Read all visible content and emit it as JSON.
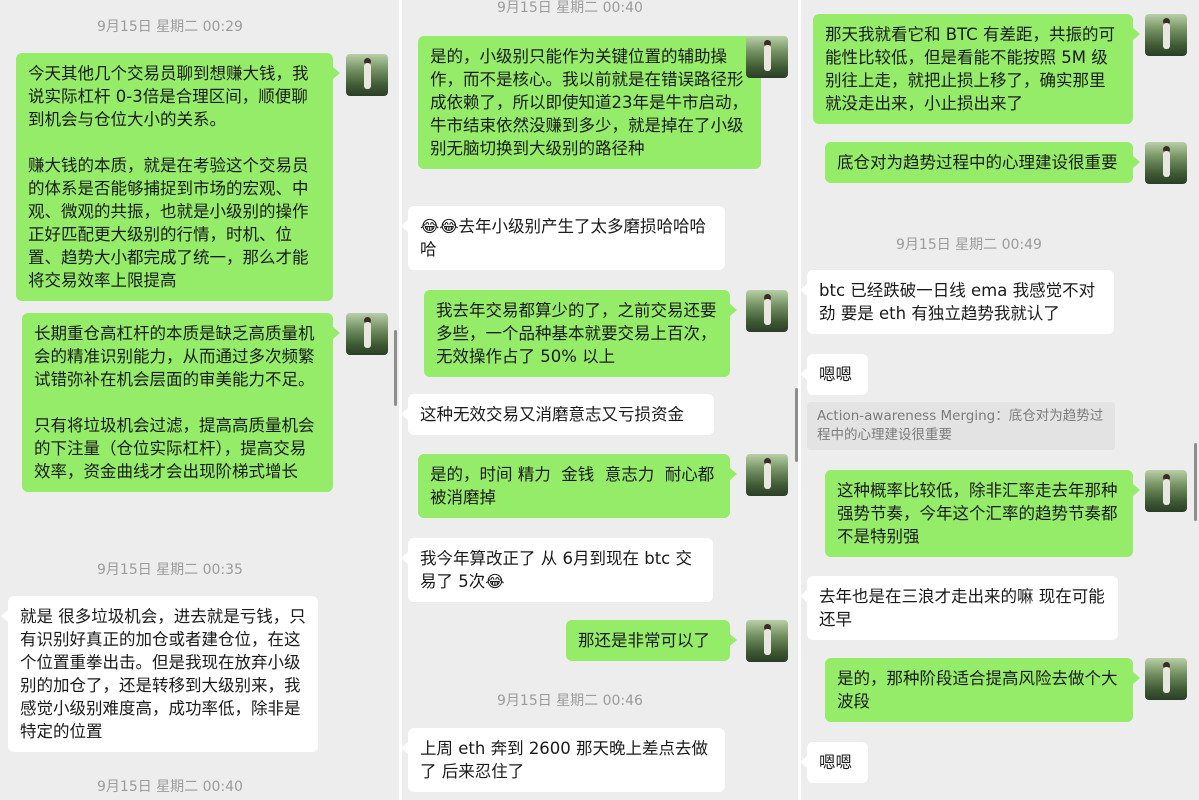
{
  "panel1": {
    "ts1": "9月15日 星期二 00:29",
    "msg1": "今天其他几个交易员聊到想赚大钱，我说实际杠杆 0-3倍是合理区间，顺便聊到机会与仓位大小的关系。\n\n赚大钱的本质，就是在考验这个交易员的体系是否能够捕捉到市场的宏观、中观、微观的共振，也就是小级别的操作正好匹配更大级别的行情，时机、位置、趋势大小都完成了统一，那么才能将交易效率上限提高",
    "msg2": "长期重仓高杠杆的本质是缺乏高质量机会的精准识别能力，从而通过多次频繁试错弥补在机会层面的审美能力不足。\n\n只有将垃圾机会过滤，提高高质量机会的下注量（仓位实际杠杆），提高交易效率，资金曲线才会出现阶梯式增长",
    "ts2": "9月15日 星期二 00:35",
    "msg3": "就是 很多垃圾机会，进去就是亏钱，只有识别好真正的加仓或者建仓位，在这个位置重拳出击。但是我现在放弃小级别的加仓了，还是转移到大级别来，我感觉小级别难度高，成功率低，除非是特定的位置",
    "ts3": "9月15日 星期二 00:40"
  },
  "panel2": {
    "ts_top": "9月15日 星期二 00:40",
    "msg1": "是的，小级别只能作为关键位置的辅助操作，而不是核心。我以前就是在错误路径形成依赖了，所以即使知道23年是牛市启动，牛市结束依然没赚到多少，就是掉在了小级别无脑切换到大级别的路径种",
    "msg2": "😂😂去年小级别产生了太多磨损哈哈哈哈",
    "msg3": "我去年交易都算少的了，之前交易还要多些，一个品种基本就要交易上百次，无效操作占了 50% 以上",
    "msg4": "这种无效交易又消磨意志又亏损资金",
    "msg5": "是的，时间 精力  金钱  意志力  耐心都被消磨掉",
    "msg6": "我今年算改正了 从 6月到现在 btc 交易了 5次😂",
    "msg7": "那还是非常可以了",
    "ts2": "9月15日 星期二 00:46",
    "msg8": "上周 eth 奔到 2600 那天晚上差点去做了 后来忍住了"
  },
  "panel3": {
    "msg1": "那天我就看它和 BTC 有差距，共振的可能性比较低，但是看能不能按照 5M 级别往上走，就把止损上移了，确实那里就没走出来，小止损出来了",
    "msg2": "底仓对为趋势过程中的心理建设很重要",
    "ts1": "9月15日 星期二 00:49",
    "msg3": "btc 已经跌破一日线 ema 我感觉不对劲 要是 eth 有独立趋势我就认了",
    "msg4": "嗯嗯",
    "quote": "Action-awareness Merging：底仓对为趋势过程中的心理建设很重要",
    "msg5": "这种概率比较低，除非汇率走去年那种强势节奏，今年这个汇率的趋势节奏都不是特别强",
    "msg6": "去年也是在三浪才走出来的嘛 现在可能还早",
    "msg7": "是的，那种阶段适合提高风险去做个大波段",
    "msg8": "嗯嗯"
  },
  "colors": {
    "sent_bubble": "#95ec69",
    "received_bubble": "#ffffff",
    "background": "#ededed",
    "timestamp": "#9b9b9b"
  },
  "icons": {
    "avatar": "avatar-icon"
  }
}
